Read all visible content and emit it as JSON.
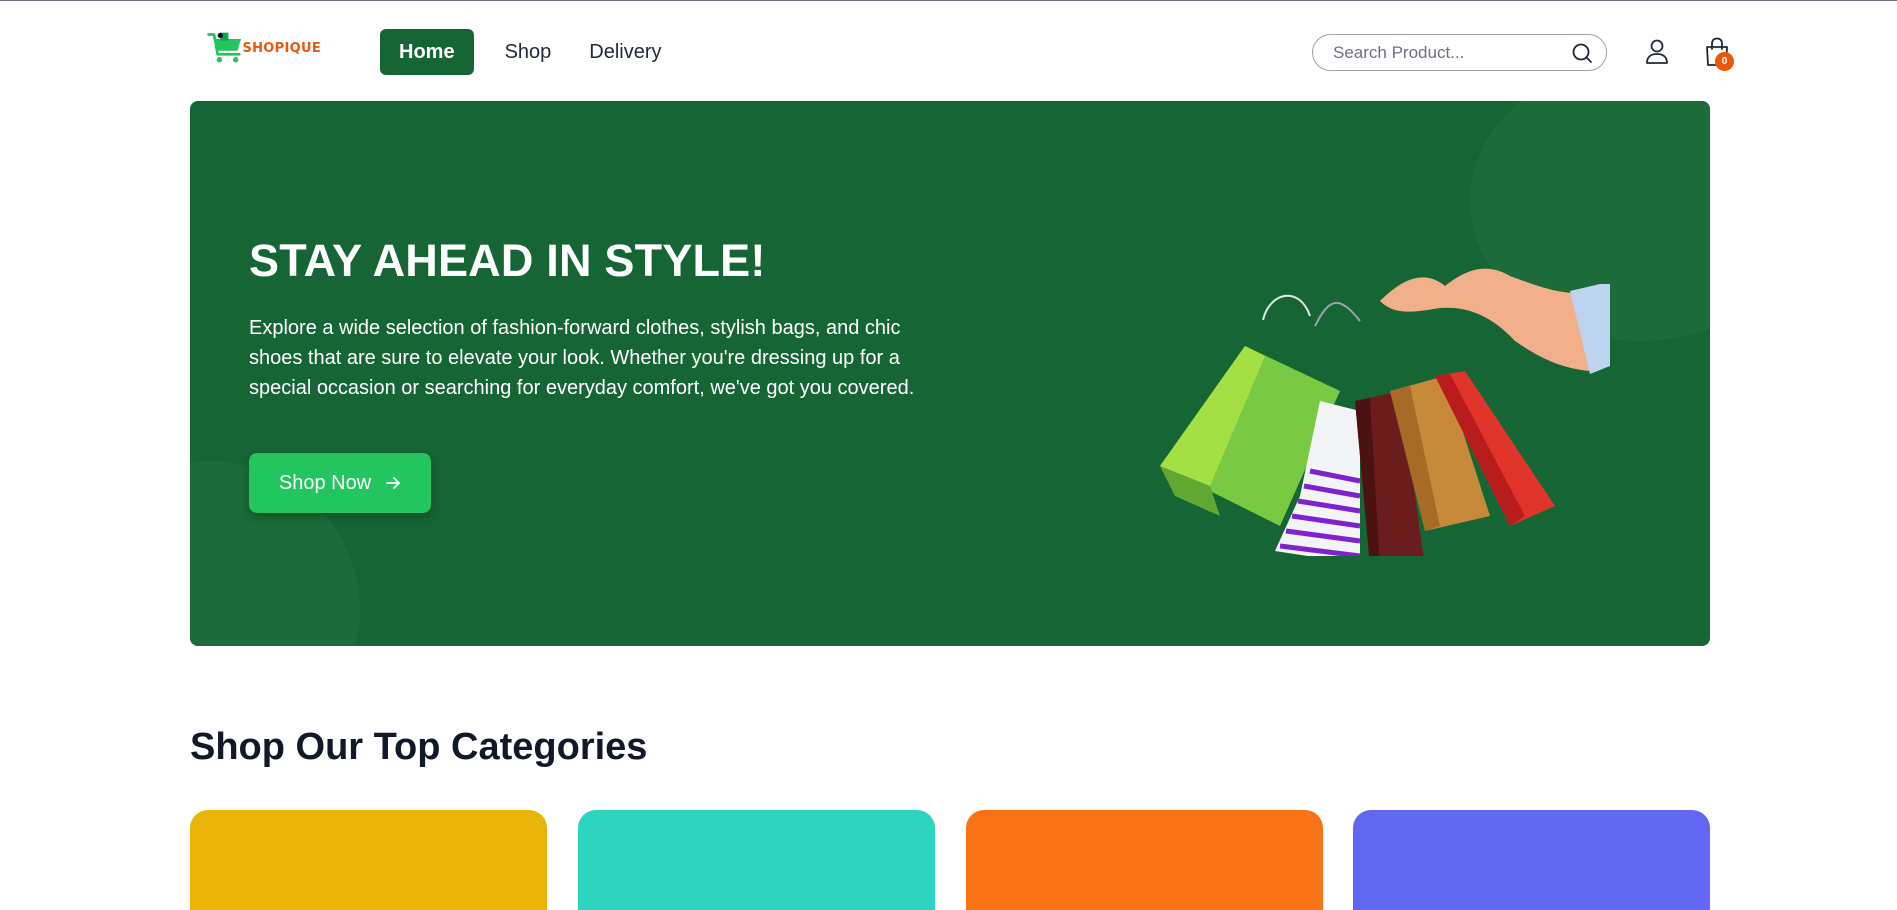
{
  "header": {
    "logo": {
      "text": "SHOPIQUE",
      "icon": "shopping-cart-logo"
    },
    "nav": [
      {
        "label": "Home",
        "active": true
      },
      {
        "label": "Shop",
        "active": false
      },
      {
        "label": "Delivery",
        "active": false
      }
    ],
    "search": {
      "placeholder": "Search Product...",
      "value": "",
      "icon": "search-icon"
    },
    "user_icon": "user-icon",
    "cart": {
      "icon": "shopping-bag-icon",
      "count": "0"
    }
  },
  "hero": {
    "title": "STAY AHEAD IN STYLE!",
    "description": "Explore a wide selection of fashion-forward clothes, stylish bags, and chic shoes that are sure to elevate your look. Whether you're dressing up for a special occasion or searching for everyday comfort, we've got you covered.",
    "button_label": "Shop Now",
    "button_icon": "arrow-right-icon",
    "image": "hand-holding-shopping-bags"
  },
  "categories": {
    "title": "Shop Our Top Categories",
    "cards": [
      {
        "color": "#eab308"
      },
      {
        "color": "#2dd4bf"
      },
      {
        "color": "#f97316"
      },
      {
        "color": "#6366f1"
      }
    ]
  },
  "colors": {
    "brand_green": "#166534",
    "button_green": "#22c55e",
    "accent_orange": "#ea580c"
  }
}
